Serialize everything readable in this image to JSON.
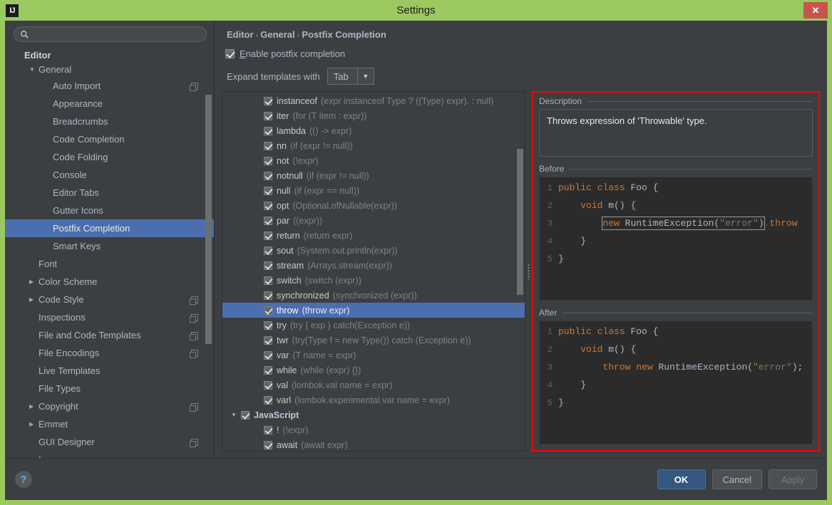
{
  "window": {
    "title": "Settings",
    "app_icon": "intellij-idea-icon",
    "close_label": "✕"
  },
  "sidebar": {
    "search": {
      "value": "",
      "placeholder": ""
    },
    "items": [
      {
        "label": "Editor",
        "indent": 0,
        "twisty": "",
        "bold": true,
        "selected": false,
        "badge": false
      },
      {
        "label": "General",
        "indent": 1,
        "twisty": "▼",
        "bold": false,
        "selected": false,
        "badge": false
      },
      {
        "label": "Auto Import",
        "indent": 2,
        "twisty": "",
        "bold": false,
        "selected": false,
        "badge": true
      },
      {
        "label": "Appearance",
        "indent": 2,
        "twisty": "",
        "bold": false,
        "selected": false,
        "badge": false
      },
      {
        "label": "Breadcrumbs",
        "indent": 2,
        "twisty": "",
        "bold": false,
        "selected": false,
        "badge": false
      },
      {
        "label": "Code Completion",
        "indent": 2,
        "twisty": "",
        "bold": false,
        "selected": false,
        "badge": false
      },
      {
        "label": "Code Folding",
        "indent": 2,
        "twisty": "",
        "bold": false,
        "selected": false,
        "badge": false
      },
      {
        "label": "Console",
        "indent": 2,
        "twisty": "",
        "bold": false,
        "selected": false,
        "badge": false
      },
      {
        "label": "Editor Tabs",
        "indent": 2,
        "twisty": "",
        "bold": false,
        "selected": false,
        "badge": false
      },
      {
        "label": "Gutter Icons",
        "indent": 2,
        "twisty": "",
        "bold": false,
        "selected": false,
        "badge": false
      },
      {
        "label": "Postfix Completion",
        "indent": 2,
        "twisty": "",
        "bold": false,
        "selected": true,
        "badge": false
      },
      {
        "label": "Smart Keys",
        "indent": 2,
        "twisty": "",
        "bold": false,
        "selected": false,
        "badge": false
      },
      {
        "label": "Font",
        "indent": 1,
        "twisty": "",
        "bold": false,
        "selected": false,
        "badge": false
      },
      {
        "label": "Color Scheme",
        "indent": 1,
        "twisty": "▶",
        "bold": false,
        "selected": false,
        "badge": false
      },
      {
        "label": "Code Style",
        "indent": 1,
        "twisty": "▶",
        "bold": false,
        "selected": false,
        "badge": true
      },
      {
        "label": "Inspections",
        "indent": 1,
        "twisty": "",
        "bold": false,
        "selected": false,
        "badge": true
      },
      {
        "label": "File and Code Templates",
        "indent": 1,
        "twisty": "",
        "bold": false,
        "selected": false,
        "badge": true
      },
      {
        "label": "File Encodings",
        "indent": 1,
        "twisty": "",
        "bold": false,
        "selected": false,
        "badge": true
      },
      {
        "label": "Live Templates",
        "indent": 1,
        "twisty": "",
        "bold": false,
        "selected": false,
        "badge": false
      },
      {
        "label": "File Types",
        "indent": 1,
        "twisty": "",
        "bold": false,
        "selected": false,
        "badge": false
      },
      {
        "label": "Copyright",
        "indent": 1,
        "twisty": "▶",
        "bold": false,
        "selected": false,
        "badge": true
      },
      {
        "label": "Emmet",
        "indent": 1,
        "twisty": "▶",
        "bold": false,
        "selected": false,
        "badge": false
      },
      {
        "label": "GUI Designer",
        "indent": 1,
        "twisty": "",
        "bold": false,
        "selected": false,
        "badge": true
      },
      {
        "label": "Images",
        "indent": 1,
        "twisty": "",
        "bold": false,
        "selected": false,
        "badge": false
      }
    ]
  },
  "breadcrumb": {
    "parts": [
      "Editor",
      "General",
      "Postfix Completion"
    ],
    "separator": "›"
  },
  "options": {
    "enable_postfix_label": "Enable postfix completion",
    "enable_postfix_checked": true,
    "expand_label": "Expand templates with",
    "expand_value": "Tab"
  },
  "templates": [
    {
      "name": "instanceof",
      "desc": "(expr instanceof Type ? ((Type) expr). : null)",
      "indent": 1,
      "checked": true,
      "selected": false,
      "group": false,
      "twisty": ""
    },
    {
      "name": "iter",
      "desc": "(for (T item : expr))",
      "indent": 1,
      "checked": true,
      "selected": false,
      "group": false,
      "twisty": ""
    },
    {
      "name": "lambda",
      "desc": "(() -> expr)",
      "indent": 1,
      "checked": true,
      "selected": false,
      "group": false,
      "twisty": ""
    },
    {
      "name": "nn",
      "desc": "(if (expr != null))",
      "indent": 1,
      "checked": true,
      "selected": false,
      "group": false,
      "twisty": ""
    },
    {
      "name": "not",
      "desc": "(!expr)",
      "indent": 1,
      "checked": true,
      "selected": false,
      "group": false,
      "twisty": ""
    },
    {
      "name": "notnull",
      "desc": "(if (expr != null))",
      "indent": 1,
      "checked": true,
      "selected": false,
      "group": false,
      "twisty": ""
    },
    {
      "name": "null",
      "desc": "(if (expr == null))",
      "indent": 1,
      "checked": true,
      "selected": false,
      "group": false,
      "twisty": ""
    },
    {
      "name": "opt",
      "desc": "(Optional.ofNullable(expr))",
      "indent": 1,
      "checked": true,
      "selected": false,
      "group": false,
      "twisty": ""
    },
    {
      "name": "par",
      "desc": "((expr))",
      "indent": 1,
      "checked": true,
      "selected": false,
      "group": false,
      "twisty": ""
    },
    {
      "name": "return",
      "desc": "(return expr)",
      "indent": 1,
      "checked": true,
      "selected": false,
      "group": false,
      "twisty": ""
    },
    {
      "name": "sout",
      "desc": "(System.out.println(expr))",
      "indent": 1,
      "checked": true,
      "selected": false,
      "group": false,
      "twisty": ""
    },
    {
      "name": "stream",
      "desc": "(Arrays.stream(expr))",
      "indent": 1,
      "checked": true,
      "selected": false,
      "group": false,
      "twisty": ""
    },
    {
      "name": "switch",
      "desc": "(switch (expr))",
      "indent": 1,
      "checked": true,
      "selected": false,
      "group": false,
      "twisty": ""
    },
    {
      "name": "synchronized",
      "desc": "(synchronized (expr))",
      "indent": 1,
      "checked": true,
      "selected": false,
      "group": false,
      "twisty": ""
    },
    {
      "name": "throw",
      "desc": "(throw expr)",
      "indent": 1,
      "checked": true,
      "selected": true,
      "group": false,
      "twisty": ""
    },
    {
      "name": "try",
      "desc": "(try { exp } catch(Exception e))",
      "indent": 1,
      "checked": true,
      "selected": false,
      "group": false,
      "twisty": ""
    },
    {
      "name": "twr",
      "desc": "(try(Type f = new Type()) catch (Exception e))",
      "indent": 1,
      "checked": true,
      "selected": false,
      "group": false,
      "twisty": ""
    },
    {
      "name": "var",
      "desc": "(T name = expr)",
      "indent": 1,
      "checked": true,
      "selected": false,
      "group": false,
      "twisty": ""
    },
    {
      "name": "while",
      "desc": "(while (expr) {})",
      "indent": 1,
      "checked": true,
      "selected": false,
      "group": false,
      "twisty": ""
    },
    {
      "name": "val",
      "desc": "(lombok.val name = expr)",
      "indent": 1,
      "checked": true,
      "selected": false,
      "group": false,
      "twisty": ""
    },
    {
      "name": "varl",
      "desc": "(lombok.experimental.var name = expr)",
      "indent": 1,
      "checked": true,
      "selected": false,
      "group": false,
      "twisty": ""
    },
    {
      "name": "JavaScript",
      "desc": "",
      "indent": 0,
      "checked": true,
      "selected": false,
      "group": true,
      "twisty": "▼"
    },
    {
      "name": "!",
      "desc": "(!expr)",
      "indent": 1,
      "checked": true,
      "selected": false,
      "group": false,
      "twisty": ""
    },
    {
      "name": "await",
      "desc": "(await expr)",
      "indent": 1,
      "checked": true,
      "selected": false,
      "group": false,
      "twisty": ""
    }
  ],
  "detail": {
    "description_title": "Description",
    "description_text": "Throws expression of 'Throwable' type.",
    "before_title": "Before",
    "after_title": "After",
    "before_code": [
      {
        "n": "1",
        "tokens": [
          {
            "t": "public",
            "c": "kw"
          },
          {
            "t": " ",
            "c": "dot"
          },
          {
            "t": "class",
            "c": "kw"
          },
          {
            "t": " ",
            "c": "dot"
          },
          {
            "t": "Foo",
            "c": "txt"
          },
          {
            "t": " ",
            "c": "dot"
          },
          {
            "t": "{",
            "c": "txt"
          }
        ]
      },
      {
        "n": "2",
        "tokens": [
          {
            "t": "    ",
            "c": "dot"
          },
          {
            "t": "void",
            "c": "kw"
          },
          {
            "t": " ",
            "c": "dot"
          },
          {
            "t": "m()",
            "c": "txt"
          },
          {
            "t": " ",
            "c": "dot"
          },
          {
            "t": "{",
            "c": "txt"
          }
        ]
      },
      {
        "n": "3",
        "tokens": [
          {
            "t": "        ",
            "c": "dot"
          },
          {
            "t": "new",
            "c": "kw box-start"
          },
          {
            "t": " ",
            "c": "dot boxed-mid"
          },
          {
            "t": "RuntimeException(",
            "c": "txt boxed-mid"
          },
          {
            "t": "\"error\"",
            "c": "str boxed-mid"
          },
          {
            "t": ")",
            "c": "txt box-end"
          },
          {
            "t": ".",
            "c": "dot"
          },
          {
            "t": "throw",
            "c": "kw"
          }
        ]
      },
      {
        "n": "4",
        "tokens": [
          {
            "t": "    ",
            "c": "dot"
          },
          {
            "t": "}",
            "c": "txt"
          }
        ]
      },
      {
        "n": "5",
        "tokens": [
          {
            "t": "}",
            "c": "txt"
          }
        ]
      }
    ],
    "after_code": [
      {
        "n": "1",
        "tokens": [
          {
            "t": "public",
            "c": "kw"
          },
          {
            "t": " ",
            "c": "dot"
          },
          {
            "t": "class",
            "c": "kw"
          },
          {
            "t": " ",
            "c": "dot"
          },
          {
            "t": "Foo",
            "c": "txt"
          },
          {
            "t": " ",
            "c": "dot"
          },
          {
            "t": "{",
            "c": "txt"
          }
        ]
      },
      {
        "n": "2",
        "tokens": [
          {
            "t": "    ",
            "c": "dot"
          },
          {
            "t": "void",
            "c": "kw"
          },
          {
            "t": " ",
            "c": "dot"
          },
          {
            "t": "m()",
            "c": "txt"
          },
          {
            "t": " ",
            "c": "dot"
          },
          {
            "t": "{",
            "c": "txt"
          }
        ]
      },
      {
        "n": "3",
        "tokens": [
          {
            "t": "        ",
            "c": "dot"
          },
          {
            "t": "throw",
            "c": "kw"
          },
          {
            "t": " ",
            "c": "dot"
          },
          {
            "t": "new",
            "c": "kw"
          },
          {
            "t": " ",
            "c": "dot"
          },
          {
            "t": "RuntimeException(",
            "c": "txt"
          },
          {
            "t": "\"error\"",
            "c": "str"
          },
          {
            "t": ");",
            "c": "txt"
          }
        ]
      },
      {
        "n": "4",
        "tokens": [
          {
            "t": "    ",
            "c": "dot"
          },
          {
            "t": "}",
            "c": "txt"
          }
        ]
      },
      {
        "n": "5",
        "tokens": [
          {
            "t": "}",
            "c": "txt"
          }
        ]
      }
    ]
  },
  "footer": {
    "help_label": "?",
    "ok_label": "OK",
    "cancel_label": "Cancel",
    "apply_label": "Apply",
    "apply_disabled": true
  },
  "colors": {
    "window_frame": "#9cc860",
    "panel_bg": "#3c3f41",
    "selection": "#4b6eaf",
    "highlight_border": "#ff0000",
    "close_btn": "#c75450",
    "code_bg": "#2b2b2b"
  }
}
